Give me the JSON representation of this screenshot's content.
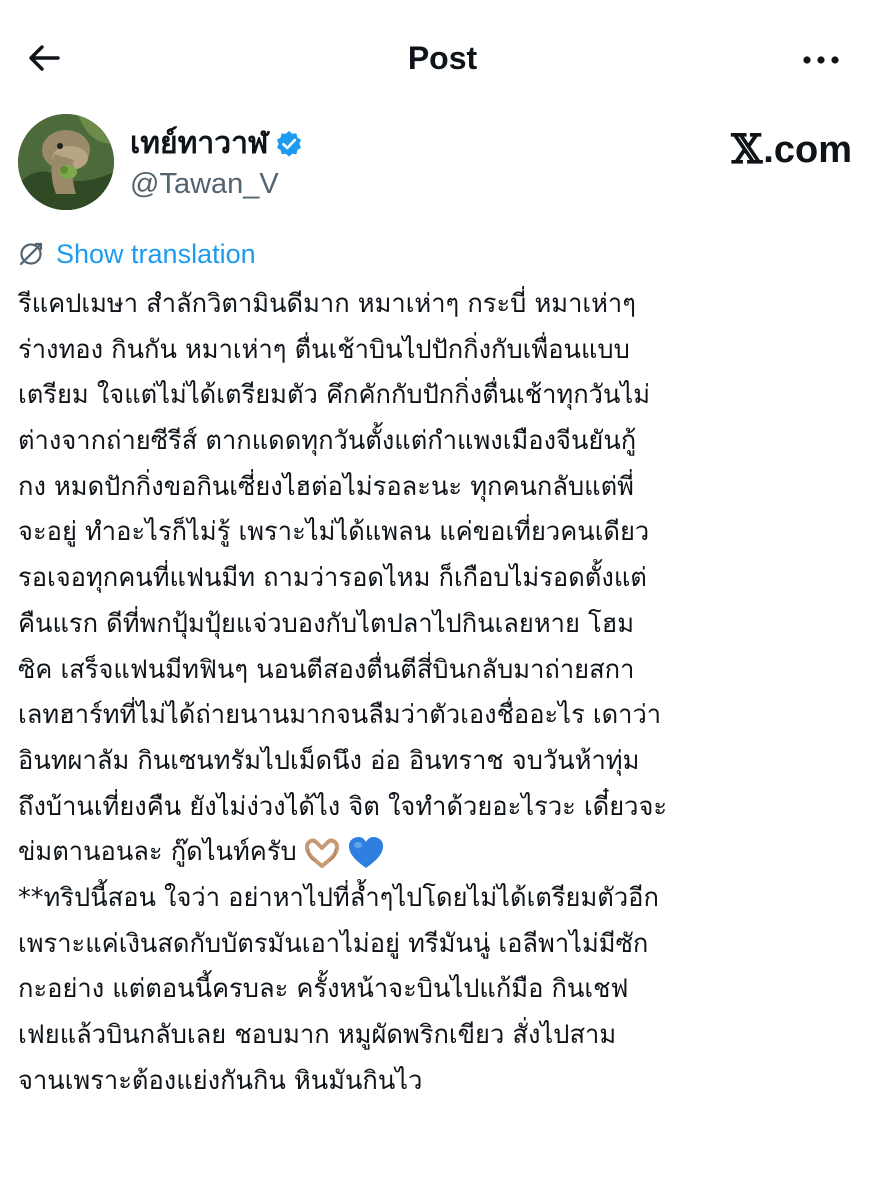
{
  "header": {
    "title": "Post",
    "back_icon": "arrow-left-icon",
    "more_icon": "more-horizontal-icon"
  },
  "author": {
    "display_name": "เทย์ทาวาฬ",
    "handle": "@Tawan_V",
    "verified": true,
    "verified_color": "#1d9bf0",
    "avatar_icon": "cartoon-dinosaur-avatar"
  },
  "watermark": {
    "x_mark": "𝕏",
    "text": ".com"
  },
  "translation": {
    "label": "Show translation",
    "icon": "translate-icon",
    "color": "#1d9bf0"
  },
  "post": {
    "lines": [
      "รีแคปเมษา สำลักวิตามินดีมาก หมาเห่าๆ กระบี่ หมาเห่าๆ",
      "ร่างทอง กินกัน หมาเห่าๆ ตื่นเช้าบินไปปักกิ่งกับเพื่อนแบบ",
      "เตรียม ใจแต่ไม่ได้เตรียมตัว คึกคักกับปักกิ่งตื่นเช้าทุกวันไม่",
      "ต่างจากถ่ายซีรีส์ ตากแดดทุกวันตั้งแต่กำแพงเมืองจีนยันกู้",
      "กง หมดปักกิ่งขอกินเซี่ยงไฮต่อไม่รอละนะ ทุกคนกลับแต่พี่",
      "จะอยู่ ทำอะไรก็ไม่รู้ เพราะไม่ได้แพลน แค่ขอเที่ยวคนเดียว",
      "รอเจอทุกคนที่แฟนมีท ถามว่ารอดไหม ก็เกือบไม่รอดตั้งแต่",
      "คืนแรก ดีที่พกปุ้มปุ้ยแจ่วบองกับไตปลาไปกินเลยหาย โฮม",
      "ซิค เสร็จแฟนมีทฟินๆ นอนตีสองตื่นตีสี่บินกลับมาถ่ายสกา",
      "เลทฮาร์ทที่ไม่ได้ถ่ายนานมากจนลืมว่าตัวเองชื่ออะไร เดาว่า",
      "อินทผาลัม กินเซนทรัมไปเม็ดนึง อ่อ อินทราช จบวันห้าทุ่ม",
      "ถึงบ้านเที่ยงคืน ยังไม่ง่วงได้ไง จิต ใจทำด้วยอะไรวะ เดี๋ยวจะ",
      "ข่มตานอนละ กู๊ดไนท์ครับ",
      "**ทริปนี้สอน ใจว่า อย่าหาไปที่ล้ำๆไปโดยไม่ได้เตรียมตัวอีก",
      "เพราะแค่เงินสดกับบัตรมันเอาไม่อยู่ ทรีมันนู่ เอลีพาไม่มีซัก",
      "กะอย่าง แต่ตอนนี้ครบละ ครั้งหน้าจะบินไปแก้มือ กินเชฟ",
      "เฟยแล้วบินกลับเลย ชอบมาก หมูผัดพริกเขียว สั่งไปสาม",
      "จานเพราะต้องแย่งกันกิน หินมันกินไว"
    ],
    "emojis_after_line_13": [
      "heart-hands-emoji",
      "blue-heart-emoji"
    ],
    "emoji_colors": {
      "heart_hands": "#c89a74",
      "blue_heart": "#2f7fe0"
    }
  }
}
